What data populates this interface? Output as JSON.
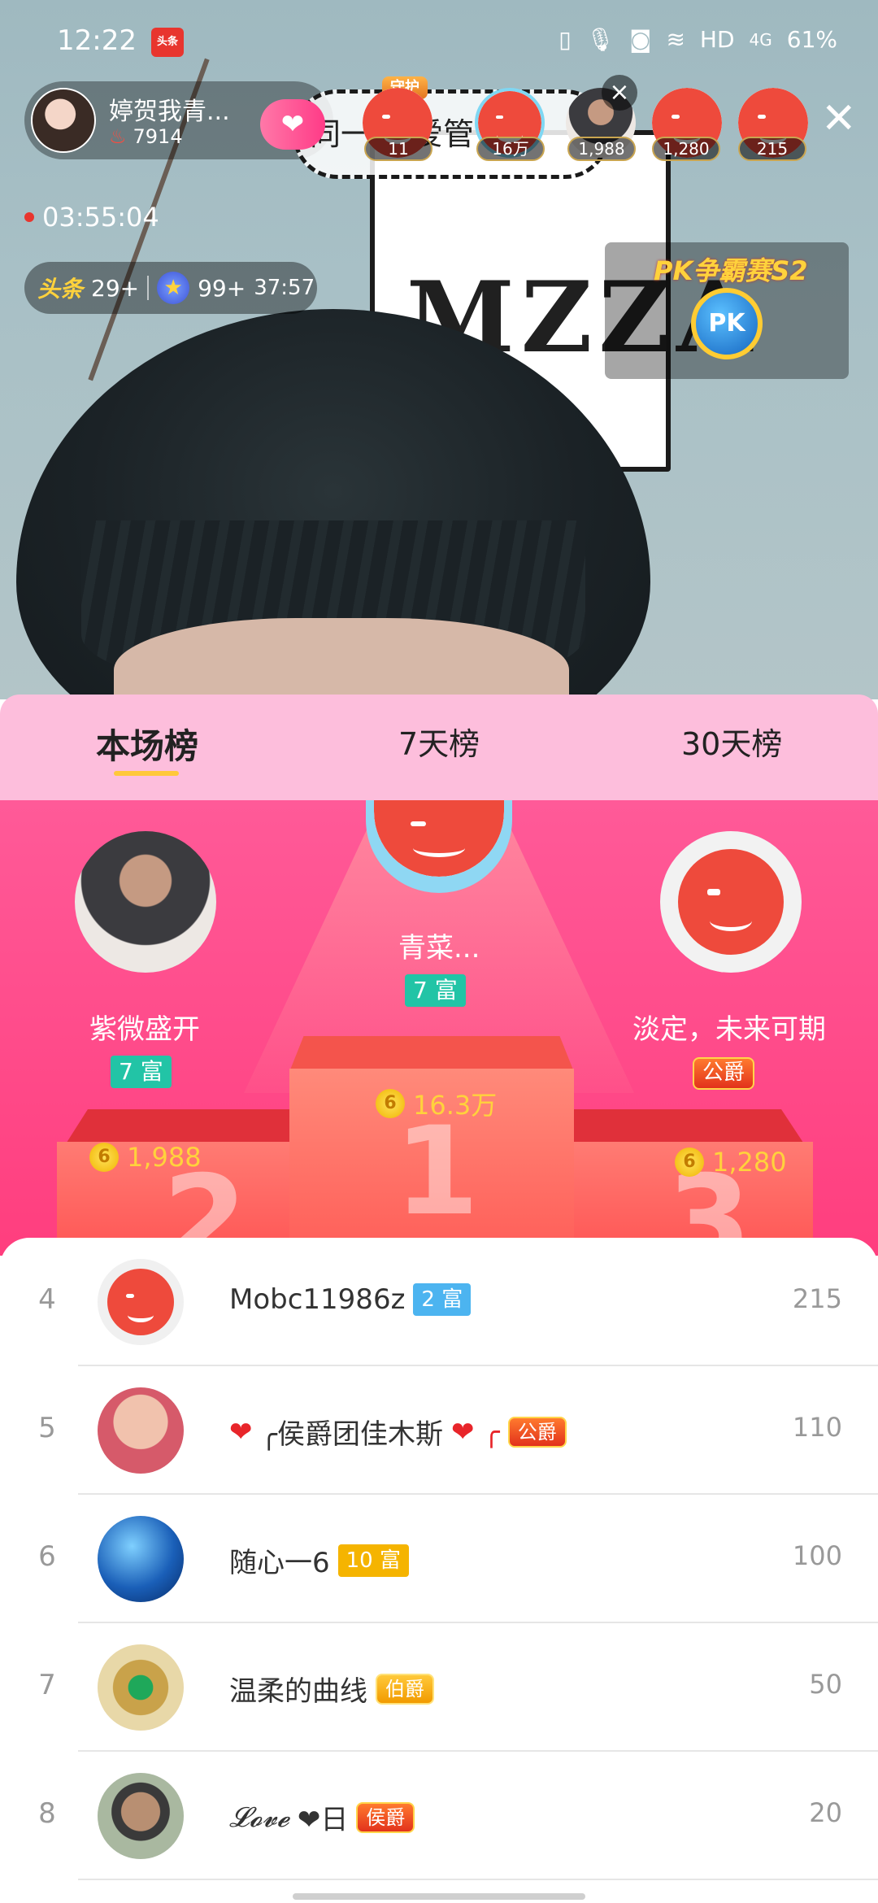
{
  "status_bar": {
    "time": "12:22",
    "app_icon_label": "头条",
    "network": "HD",
    "signal": "4G",
    "battery": "61%"
  },
  "live": {
    "anchor": {
      "name": "婷贺我青...",
      "heat": "7914"
    },
    "marquee_text": "同一惊    爱管    发",
    "viewers": [
      {
        "badge": "11",
        "guard_label": "守护"
      },
      {
        "badge": "16万"
      },
      {
        "badge": "1,988"
      },
      {
        "badge": "1,280"
      },
      {
        "badge": "215"
      }
    ],
    "timer": "03:55:04",
    "rank_chip": {
      "toutiao_label": "头条",
      "toutiao_rank": "29+",
      "star_rank": "99+",
      "countdown": "37:57"
    },
    "pk": {
      "title": "PK争霸赛S2",
      "button_label": "PK"
    }
  },
  "leaderboard": {
    "tabs": [
      "本场榜",
      "7天榜",
      "30天榜"
    ],
    "active_tab": 0,
    "podium": {
      "first": {
        "name": "青菜...",
        "badge": "7 富",
        "score": "16.3万",
        "rank_digit": "1"
      },
      "second": {
        "name": "紫微盛开",
        "badge": "7 富",
        "score": "1,988",
        "rank_digit": "2"
      },
      "third": {
        "name": "淡定，未来可期",
        "badge": "公爵",
        "score": "1,280",
        "rank_digit": "3"
      }
    },
    "coin_symbol": "6",
    "rows": [
      {
        "rank": "4",
        "name": "Mobc11986z",
        "badge": "2 富",
        "score": "215"
      },
      {
        "rank": "5",
        "name_prefix": "❤",
        "name": "╭侯爵团佳木斯",
        "name_suffix": "❤ ╭",
        "badge": "公爵",
        "score": "110"
      },
      {
        "rank": "6",
        "name": "随心一6",
        "badge": "10 富",
        "score": "100"
      },
      {
        "rank": "7",
        "name": "温柔的曲线",
        "badge": "伯爵",
        "score": "50"
      },
      {
        "rank": "8",
        "name": "𝓛𝓸𝓿𝓮",
        "name_suffix": "❤日",
        "badge": "侯爵",
        "score": "20"
      }
    ]
  }
}
